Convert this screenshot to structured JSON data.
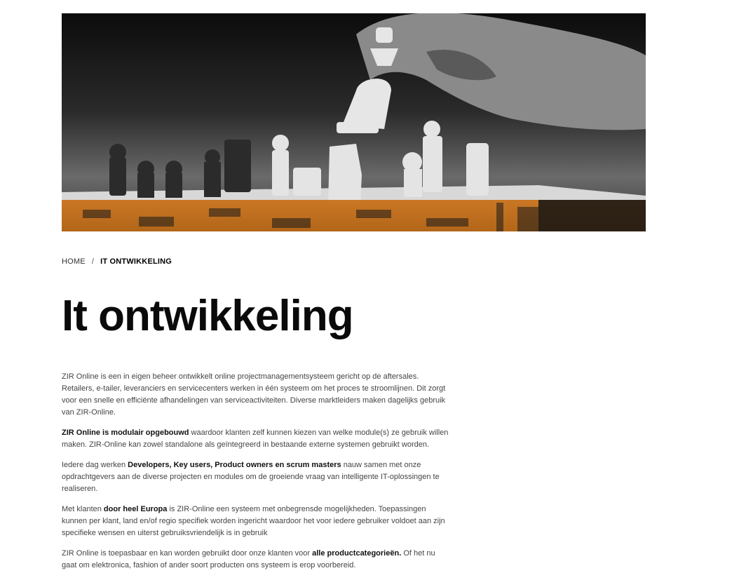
{
  "breadcrumb": {
    "home": "HOME",
    "separator": "/",
    "current": "IT ONTWIKKELING"
  },
  "page_title": "It ontwikkeling",
  "hero": {
    "icon": "chess-hero-image",
    "accent_color": "#e8891c"
  },
  "content": {
    "p1": "ZIR Online is een in eigen beheer ontwikkelt online projectmanagementsysteem gericht op de aftersales. Retailers, e-tailer, leveranciers en servicecenters werken in één systeem om het proces te stroomlijnen. Dit zorgt voor een snelle en efficiënte afhandelingen van serviceactiviteiten. Diverse marktleiders maken dagelijks gebruik van ZIR-Online.",
    "p2_bold": "ZIR Online is modulair opgebouwd",
    "p2_rest": " waardoor klanten zelf kunnen kiezen van welke module(s) ze gebruik willen maken. ZIR-Online kan zowel standalone als geïntegreerd in bestaande externe systemen gebruikt worden.",
    "p3_pre": "Iedere dag werken ",
    "p3_bold": "Developers, Key users, Product owners en scrum masters",
    "p3_rest": " nauw samen met onze opdrachtgevers aan de diverse projecten en modules om de groeiende vraag van intelligente IT-oplossingen te realiseren.",
    "p4_pre": "Met klanten ",
    "p4_bold": "door heel Europa",
    "p4_rest": " is ZIR-Online een systeem met onbegrensde mogelijkheden. Toepassingen kunnen per klant, land en/of regio specifiek worden ingericht waardoor het voor iedere gebruiker voldoet aan zijn specifieke wensen en uiterst gebruiksvriendelijk is in gebruik",
    "p5_pre": "ZIR Online is toepasbaar en kan worden gebruikt door onze klanten voor ",
    "p5_bold": "alle productcategorieën.",
    "p5_rest": " Of het nu gaat om elektronica, fashion of ander soort producten ons systeem is erop voorbereid."
  }
}
